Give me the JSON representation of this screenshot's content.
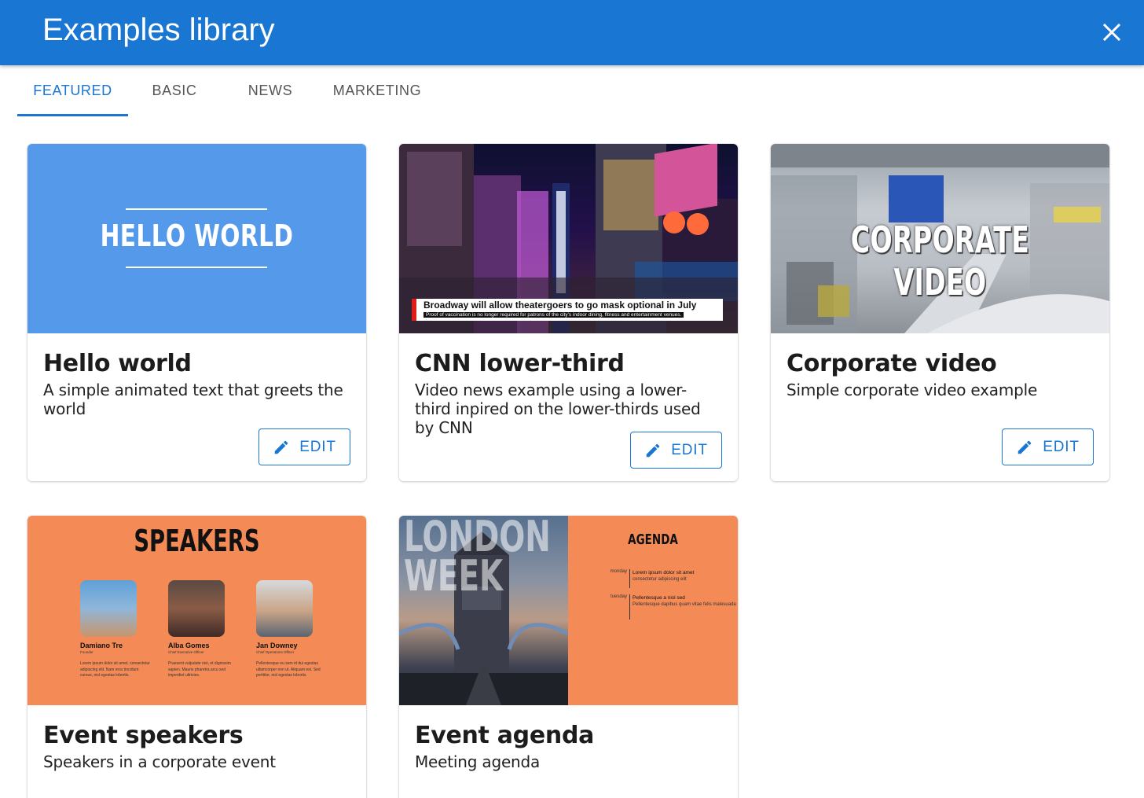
{
  "dialog": {
    "title": "Examples library",
    "close_icon": "close-icon",
    "header_color": "#1976d2"
  },
  "tabs": [
    {
      "label": "FEATURED",
      "active": true
    },
    {
      "label": "BASIC",
      "active": false
    },
    {
      "label": "NEWS",
      "active": false
    },
    {
      "label": "MARKETING",
      "active": false
    }
  ],
  "cards": [
    {
      "title": "Hello world",
      "description": "A simple animated text that greets the world",
      "edit_label": "EDIT",
      "edit_icon": "pencil-icon",
      "thumbnail": {
        "text": "HELLO WORLD",
        "bg": "#5599ea"
      }
    },
    {
      "title": "CNN lower-third",
      "description": "Video news example using a lower-third inpired on the lower-thirds used by CNN",
      "edit_label": "EDIT",
      "edit_icon": "pencil-icon",
      "thumbnail": {
        "headline": "Broadway will allow theatergoers to go mask optional in July",
        "subline": "Proof of vaccination is no longer required for patrons of the city's indoor dining, fitness and entertainment venues."
      }
    },
    {
      "title": "Corporate video",
      "description": "Simple corporate video example",
      "edit_label": "EDIT",
      "edit_icon": "pencil-icon",
      "thumbnail": {
        "text": "CORPORATE VIDEO"
      }
    },
    {
      "title": "Event speakers",
      "description": "Speakers in a corporate event",
      "thumbnail": {
        "heading": "SPEAKERS",
        "bg": "#f48b57",
        "speakers": [
          {
            "name": "Damiano Tre",
            "role": "Founder",
            "bio": "Lorem ipsum dolor sit amet, consectetur adipiscing elit. Nam eros tincidunt cursus, nisl egestas lobortis."
          },
          {
            "name": "Alba Gomes",
            "role": "Chief Executive Officer",
            "bio": "Praesent vulputate nisi, et dignissim sapien. Mauris pharetra arcu sed imperdiet ultricies."
          },
          {
            "name": "Jan Downey",
            "role": "Chief Operations Officer",
            "bio": "Pellentesque eu sem id dui egestas ullamcorper non ut. Aliquam est. Sed porttitor, nisl egestas lobortis."
          }
        ]
      }
    },
    {
      "title": "Event agenda",
      "description": "Meeting agenda",
      "thumbnail": {
        "overlay": "LONDON WEEK",
        "heading": "AGENDA",
        "bg": "#f48b57",
        "rows": [
          {
            "day": "monday",
            "title": "Lorem ipsum dolor sit amet",
            "detail": "consectetur adipiscing elit"
          },
          {
            "day": "tuesday",
            "title": "Pellentesque a nisl sed",
            "detail": "Pellentesque dapibus quam vitae felis malesuada"
          }
        ]
      }
    }
  ]
}
